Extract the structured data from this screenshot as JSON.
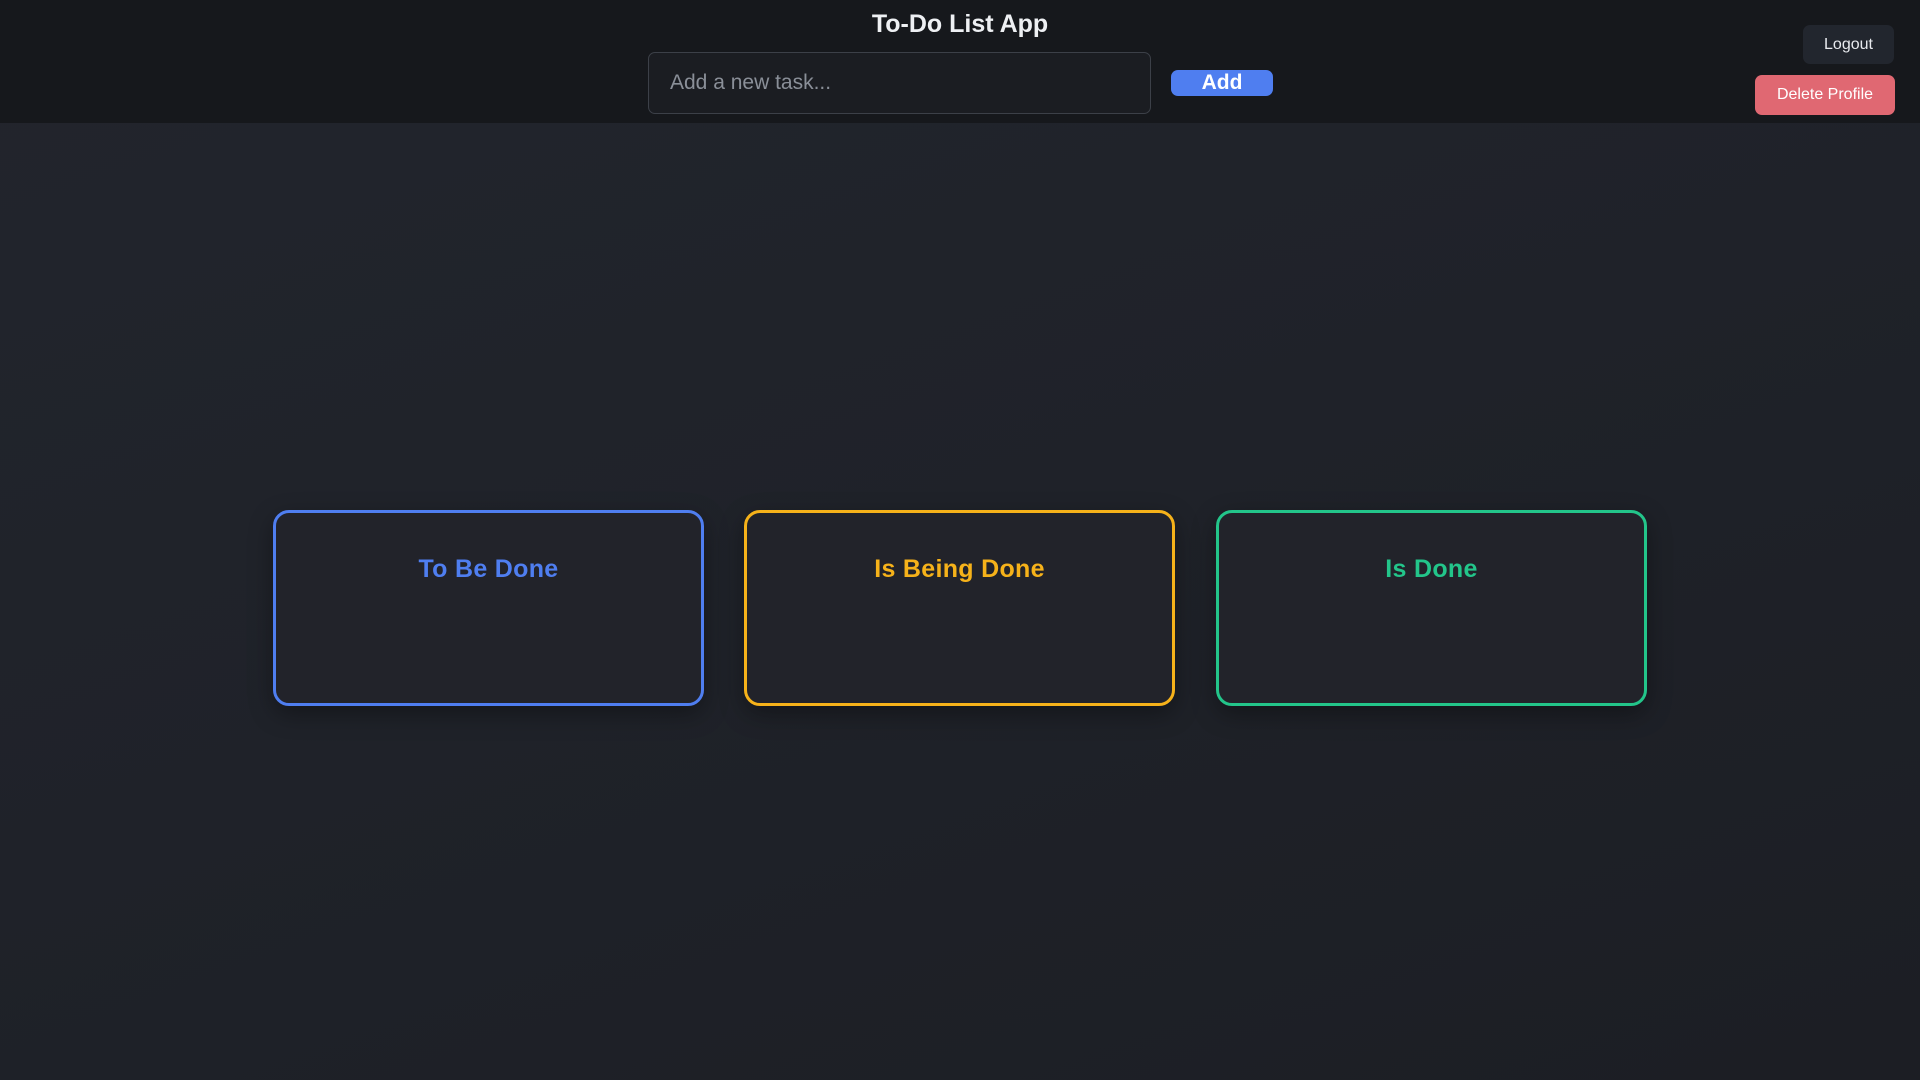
{
  "header": {
    "title": "To-Do List App",
    "task_input": {
      "value": "",
      "placeholder": "Add a new task..."
    },
    "add_label": "Add",
    "logout_label": "Logout",
    "delete_profile_label": "Delete Profile"
  },
  "columns": [
    {
      "title": "To Be Done",
      "color": "#4f7ef0",
      "tasks": []
    },
    {
      "title": "Is Being Done",
      "color": "#f6b21a",
      "tasks": []
    },
    {
      "title": "Is Done",
      "color": "#23c58a",
      "tasks": []
    }
  ],
  "colors": {
    "background": "#1f2229",
    "header_background": "#16181c",
    "accent": "#4f7ef0",
    "danger": "#e06872"
  }
}
